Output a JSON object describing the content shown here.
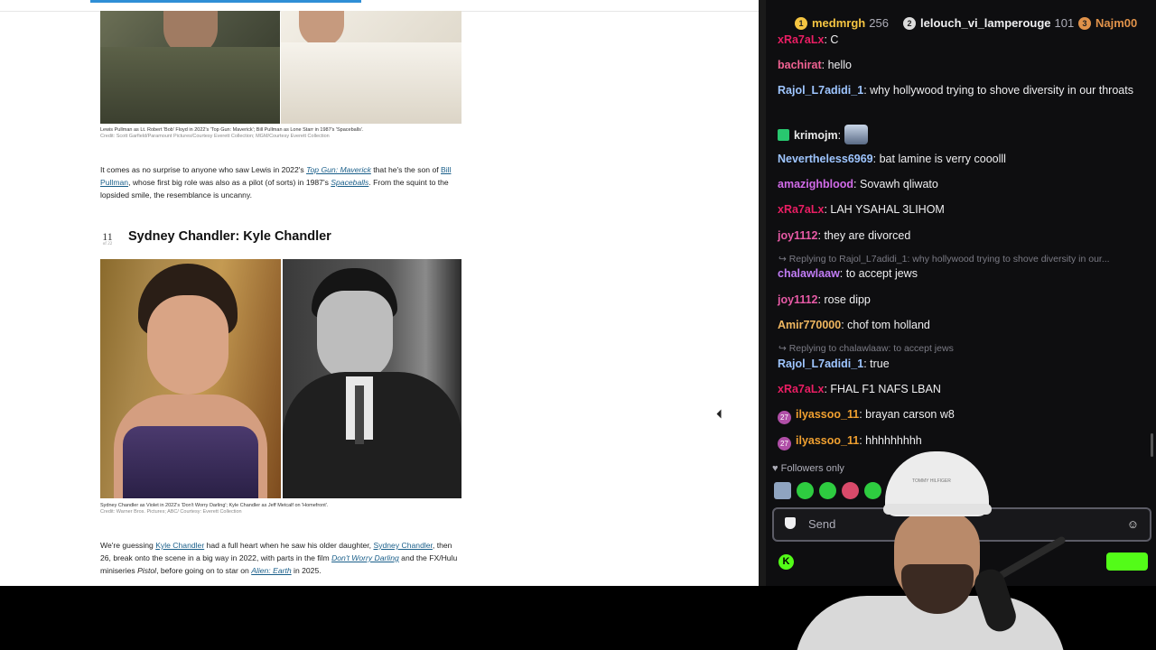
{
  "article": {
    "caption1": "Lewis Pullman as Lt. Robert 'Bob' Floyd in 2022's 'Top Gun: Maverick'; Bill Pullman as Lone Starr in 1987's 'Spaceballs'.",
    "credit1": "Credit: Scott Garfield/Paramount Pictures/Courtesy Everett Collection; MGM/Courtesy Everett Collection",
    "para1": {
      "t1": "It comes as no surprise to anyone who saw Lewis in 2022's ",
      "link1": "Top Gun: Maverick",
      "t2": " that he's the son of ",
      "link2": "Bill Pullman",
      "t3": ", whose first big role was also as a pilot (of sorts) in 1987's ",
      "link3": "Spaceballs",
      "t4": ". From the squint to the lopsided smile, the resemblance is uncanny."
    },
    "item_number": "11",
    "item_of": "of 22",
    "heading": "Sydney Chandler: Kyle Chandler",
    "caption2": "Sydney Chandler as Violet in 2022's 'Don't Worry Darling'; Kyle Chandler as Jeff Metcalf on 'Homefront'.",
    "credit2": "Credit: Warner Bros. Pictures; ABC/ Courtesy: Everett Collection",
    "para2": {
      "t1": "We're guessing ",
      "link1": "Kyle Chandler",
      "t2": " had a full heart when he saw his older daughter, ",
      "link2": "Sydney Chandler",
      "t3": ", then 26, break onto the scene in a big way in 2022, with parts in the film ",
      "link3": "Don't Worry Darling",
      "t4": " and the FX/Hulu miniseries ",
      "it1": "Pistol",
      "t5": ", before going on to star on ",
      "link4": "Alien: Earth",
      "t6": " in 2025."
    }
  },
  "chat": {
    "leaderboard": [
      {
        "rank": "1",
        "name": "medmrgh",
        "count": "256",
        "color": "#f5c542"
      },
      {
        "rank": "2",
        "name": "lelouch_vi_lamperouge",
        "count": "101",
        "color": "#dcdcdc"
      },
      {
        "rank": "3",
        "name": "Najm00",
        "count": "",
        "color": "#e0924a"
      }
    ],
    "messages": [
      {
        "user": "xRa7aLx",
        "text": "C",
        "color": "#e91e63"
      },
      {
        "user": "bachirat",
        "text": "hello",
        "color": "#f06292"
      },
      {
        "user": "Rajol_L7adidi_1",
        "text": "why hollywood trying to shove diversity in our throats",
        "color": "#9ec5ff"
      },
      {
        "user": "krimojm",
        "text": "",
        "color": "#eaeaea"
      },
      {
        "user": "Nevertheless6969",
        "text": "bat lamine is verry cooolll",
        "color": "#9ec5ff"
      },
      {
        "user": "amazighblood",
        "text": "Sovawh qliwato",
        "color": "#d16be8"
      },
      {
        "user": "xRa7aLx",
        "text": "LAH YSAHAL 3LIHOM",
        "color": "#e91e63"
      },
      {
        "user": "joy1112",
        "text": "they are divorced",
        "color": "#e75aa6"
      },
      {
        "user": "chalawlaaw",
        "text": "to accept jews",
        "color": "#c17cf5"
      },
      {
        "user": "joy1112",
        "text": "rose dipp",
        "color": "#e75aa6"
      },
      {
        "user": "Amir770000",
        "text": "chof tom holland",
        "color": "#f0b760"
      },
      {
        "user": "Rajol_L7adidi_1",
        "text": "true",
        "color": "#9ec5ff"
      },
      {
        "user": "xRa7aLx",
        "text": "FHAL F1 NAFS LBAN",
        "color": "#e91e63"
      },
      {
        "user": "ilyassoo_11",
        "text": "brayan carson w8",
        "color": "#f0a030"
      },
      {
        "user": "ilyassoo_11",
        "text": "hhhhhhhhh",
        "color": "#f0a030"
      }
    ],
    "reply1": "Replying to Rajol_L7adidi_1: why hollywood trying to shove diversity in our...",
    "reply2": "Replying to chalawlaaw: to accept jews",
    "sub_badge": "27",
    "followers_only": "Followers only",
    "input_placeholder": "Send",
    "kick_letter": "K",
    "webcam_cap_text": "TOMMY HILFIGER"
  }
}
